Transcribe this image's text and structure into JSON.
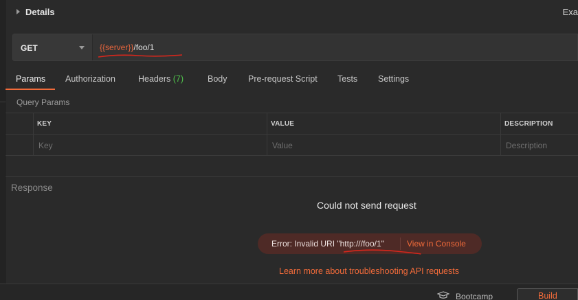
{
  "details": {
    "label": "Details",
    "right_label": "Exa"
  },
  "request": {
    "method": "GET",
    "url_variable": "{{server}}",
    "url_path": "/foo/1"
  },
  "tabs": [
    {
      "label": "Params",
      "active": true
    },
    {
      "label": "Authorization"
    },
    {
      "label": "Headers",
      "count": "(7)"
    },
    {
      "label": "Body"
    },
    {
      "label": "Pre-request Script"
    },
    {
      "label": "Tests"
    },
    {
      "label": "Settings"
    }
  ],
  "query_params": {
    "label": "Query Params",
    "columns": [
      "KEY",
      "VALUE",
      "DESCRIPTION"
    ],
    "placeholders": [
      "Key",
      "Value",
      "Description"
    ]
  },
  "response": {
    "label": "Response",
    "title": "Could not send request",
    "error_message": "Error: Invalid URI \"http:///foo/1\"",
    "error_link": "View in Console",
    "learn_more": "Learn more about troubleshooting API requests"
  },
  "footer": {
    "bootcamp_label": "Bootcamp",
    "build_label": "Build"
  },
  "colors": {
    "accent": "#f26b3a",
    "variable": "#e8663d",
    "count_green": "#4fc24b",
    "error_bg": "#4e2a26",
    "annotation_red": "#d8271c"
  }
}
